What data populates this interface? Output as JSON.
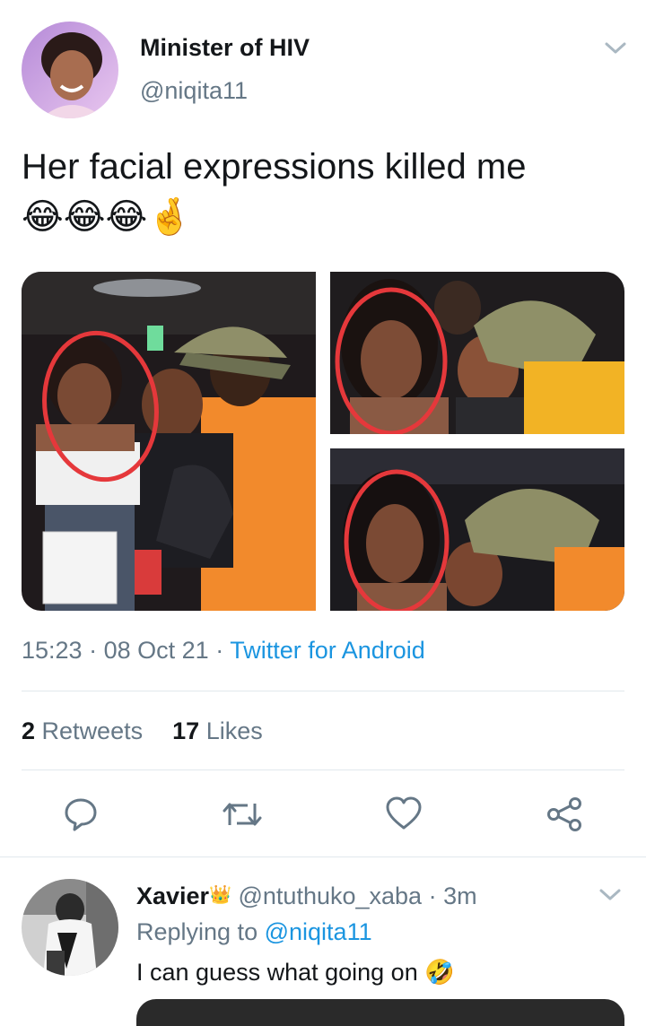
{
  "tweet": {
    "author": {
      "name": "Minister of HIV",
      "handle": "@niqita11"
    },
    "text": "Her facial expressions killed me",
    "emoji": "😂😂😂🤞",
    "meta": {
      "time": "15:23",
      "sep1": "·",
      "date": "08 Oct 21",
      "sep2": "·",
      "source": "Twitter for Android"
    },
    "stats": {
      "retweets_count": "2",
      "retweets_label": "Retweets",
      "likes_count": "17",
      "likes_label": "Likes"
    },
    "actions": [
      "reply-icon",
      "retweet-icon",
      "like-icon",
      "share-icon"
    ],
    "media_count": 3
  },
  "reply": {
    "name": "Xavier",
    "badge": "👑",
    "handle": "@ntuthuko_xaba",
    "sep": "·",
    "time": "3m",
    "replying_label": "Replying to",
    "replying_handle": "@niqita11",
    "text": "I can guess what going on",
    "emoji": "🤣"
  },
  "colors": {
    "link": "#1b95e0",
    "muted": "#657786",
    "divider": "#e1e8ed",
    "chevron": "#aab8c2"
  }
}
